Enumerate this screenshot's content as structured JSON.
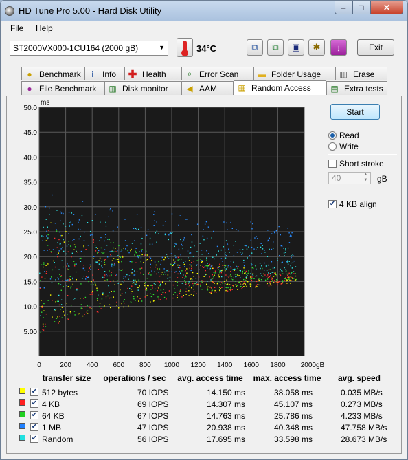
{
  "window": {
    "title": "HD Tune Pro 5.00 - Hard Disk Utility",
    "controls": {
      "minimize": "–",
      "maximize": "□",
      "close": "✕"
    }
  },
  "menu": {
    "file": "File",
    "help": "Help"
  },
  "toolbar": {
    "drive": "ST2000VX000-1CU164 (2000 gB)",
    "temperature": "34°C",
    "exit_label": "Exit",
    "icons": [
      "copy-info-icon",
      "copy-screenshot-icon",
      "save-icon",
      "options-icon",
      "download-icon"
    ]
  },
  "tabs": {
    "row1": [
      "Benchmark",
      "Info",
      "Health",
      "Error Scan",
      "Folder Usage",
      "Erase"
    ],
    "row2": [
      "File Benchmark",
      "Disk monitor",
      "AAM",
      "Random Access",
      "Extra tests"
    ],
    "active": "Random Access"
  },
  "side": {
    "start_label": "Start",
    "read_label": "Read",
    "write_label": "Write",
    "mode": "Read",
    "short_stroke_label": "Short stroke",
    "short_stroke_checked": false,
    "short_stroke_value": "40",
    "gb_label": "gB",
    "align_label": "4 KB align",
    "align_checked": true
  },
  "chart_data": {
    "type": "scatter",
    "ylabel": "ms",
    "y_ticks": [
      "50.0",
      "45.0",
      "40.0",
      "35.0",
      "30.0",
      "25.0",
      "20.0",
      "15.0",
      "10.0",
      "5.00"
    ],
    "x_ticks": [
      "0",
      "200",
      "400",
      "600",
      "800",
      "1000",
      "1200",
      "1400",
      "1600",
      "1800",
      "2000gB"
    ],
    "xlim": [
      0,
      2000
    ],
    "ylim": [
      0,
      50
    ],
    "grid": true,
    "background": "#1a1a1a",
    "series": [
      {
        "name": "512 bytes",
        "color": "#ffff00",
        "min_ms_start": 3.5,
        "min_ms_end": 15,
        "max_ms": 38.058,
        "avg_ms": 14.15
      },
      {
        "name": "4 KB",
        "color": "#ff3030",
        "min_ms_start": 3.5,
        "min_ms_end": 15,
        "max_ms": 45.107,
        "avg_ms": 14.307
      },
      {
        "name": "64 KB",
        "color": "#30e030",
        "min_ms_start": 4,
        "min_ms_end": 15.5,
        "max_ms": 25.786,
        "avg_ms": 14.763
      },
      {
        "name": "1 MB",
        "color": "#2a8cff",
        "min_ms_start": 12,
        "min_ms_end": 19,
        "max_ms": 40.348,
        "avg_ms": 20.938
      },
      {
        "name": "Random",
        "color": "#30e6e6",
        "min_ms_start": 7,
        "min_ms_end": 17,
        "max_ms": 33.598,
        "avg_ms": 17.695
      }
    ]
  },
  "results": {
    "headers": [
      "transfer size",
      "operations / sec",
      "avg. access time",
      "max. access time",
      "avg. speed"
    ],
    "rows": [
      {
        "size": "512 bytes",
        "color": "#ffff00",
        "iops": "70 IOPS",
        "avg": "14.150 ms",
        "max": "38.058 ms",
        "speed": "0.035 MB/s"
      },
      {
        "size": "4 KB",
        "color": "#ff2020",
        "iops": "69 IOPS",
        "avg": "14.307 ms",
        "max": "45.107 ms",
        "speed": "0.273 MB/s"
      },
      {
        "size": "64 KB",
        "color": "#20d020",
        "iops": "67 IOPS",
        "avg": "14.763 ms",
        "max": "25.786 ms",
        "speed": "4.233 MB/s"
      },
      {
        "size": "1 MB",
        "color": "#2080ff",
        "iops": "47 IOPS",
        "avg": "20.938 ms",
        "max": "40.348 ms",
        "speed": "47.758 MB/s"
      },
      {
        "size": "Random",
        "color": "#20e0e0",
        "iops": "56 IOPS",
        "avg": "17.695 ms",
        "max": "33.598 ms",
        "speed": "28.673 MB/s"
      }
    ]
  }
}
